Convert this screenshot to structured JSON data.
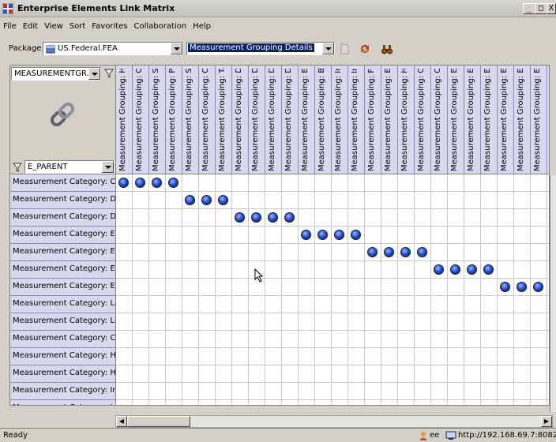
{
  "window": {
    "title": "Enterprise Elements Link Matrix",
    "buttons": [
      "_",
      "□",
      "X"
    ]
  },
  "menu": [
    "File",
    "Edit",
    "View",
    "Sort",
    "Favorites",
    "Collaboration",
    "Help"
  ],
  "toolbar": {
    "package_label": "Package:",
    "package_value": "US.Federal.FEA",
    "view_value": "Measurement Grouping Details",
    "icons": [
      "page-icon",
      "refresh-icon",
      "binoculars-icon"
    ]
  },
  "corner": {
    "column_type_value": "MEASUREMENTGR...",
    "row_type_value": "E_PARENT",
    "link_icon": "link-chain-icon"
  },
  "columns": [
    "Measurement Grouping: Ho...",
    "Measurement Grouping: Co...",
    "Measurement Grouping: So...",
    "Measurement Grouping: Po...",
    "Measurement Grouping: St...",
    "Measurement Grouping: Op...",
    "Measurement Grouping: Ta...",
    "Measurement Grouping: Dis...",
    "Measurement Grouping: Dis...",
    "Measurement Grouping: Dis...",
    "Measurement Grouping: Dis...",
    "Measurement Grouping: Em...",
    "Measurement Grouping: Bu...",
    "Measurement Grouping: In...",
    "Measurement Grouping: Int...",
    "Measurement Grouping: Fin...",
    "Measurement Grouping: Ele...",
    "Measurement Grouping: Hig...",
    "Measurement Grouping: Cul...",
    "Measurement Grouping: Cul...",
    "Measurement Grouping: En...",
    "Measurement Grouping: En...",
    "Measurement Grouping: En...",
    "Measurement Grouping: En...",
    "Measurement Grouping: En...",
    "Measurement Grouping: En...",
    "Measurement Grouping: Pol..."
  ],
  "rows": [
    {
      "label": "Measurement Category: C...",
      "links": [
        0,
        1,
        2,
        3
      ]
    },
    {
      "label": "Measurement Category: D...",
      "links": [
        4,
        5,
        6
      ]
    },
    {
      "label": "Measurement Category: Di...",
      "links": [
        7,
        8,
        9,
        10
      ]
    },
    {
      "label": "Measurement Category: Ec...",
      "links": [
        11,
        12,
        13,
        14
      ]
    },
    {
      "label": "Measurement Category: Ed...",
      "links": [
        15,
        16,
        17,
        18
      ]
    },
    {
      "label": "Measurement Category: En...",
      "links": [
        19,
        20,
        21,
        22
      ]
    },
    {
      "label": "Measurement Category: En...",
      "links": [
        23,
        24,
        25
      ]
    },
    {
      "label": "Measurement Category: La...",
      "links": []
    },
    {
      "label": "Measurement Category: Lit...",
      "links": []
    },
    {
      "label": "Measurement Category: C...",
      "links": []
    },
    {
      "label": "Measurement Category: H...",
      "links": []
    },
    {
      "label": "Measurement Category: H...",
      "links": []
    },
    {
      "label": "Measurement Category: In...",
      "links": []
    },
    {
      "label": "Measurement Category: In...",
      "links": []
    }
  ],
  "status": {
    "text": "Ready",
    "user": "ee",
    "url": "http://192.168.69.7:8082/ee"
  }
}
